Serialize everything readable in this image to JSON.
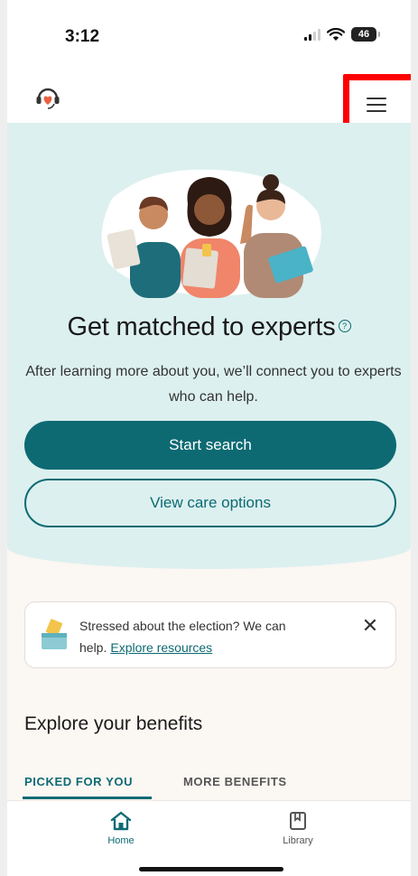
{
  "status_bar": {
    "time": "3:12",
    "battery": "46"
  },
  "hero": {
    "title": "Get matched to experts",
    "description": "After learning more about you, we’ll connect you to experts who can help.",
    "primary_button": "Start search",
    "secondary_button": "View care options"
  },
  "banner": {
    "text": "Stressed about the election? We can help.",
    "link": "Explore resources"
  },
  "benefits": {
    "title": "Explore your benefits",
    "tabs": [
      "PICKED FOR YOU",
      "MORE BENEFITS"
    ]
  },
  "bottom_nav": [
    {
      "label": "Home",
      "icon": "home-icon"
    },
    {
      "label": "Library",
      "icon": "book-icon"
    }
  ],
  "colors": {
    "accent": "#0d6a73",
    "hero_bg": "#dcf0ef",
    "page_bg": "#fbf7f3",
    "highlight": "#ff0000"
  }
}
